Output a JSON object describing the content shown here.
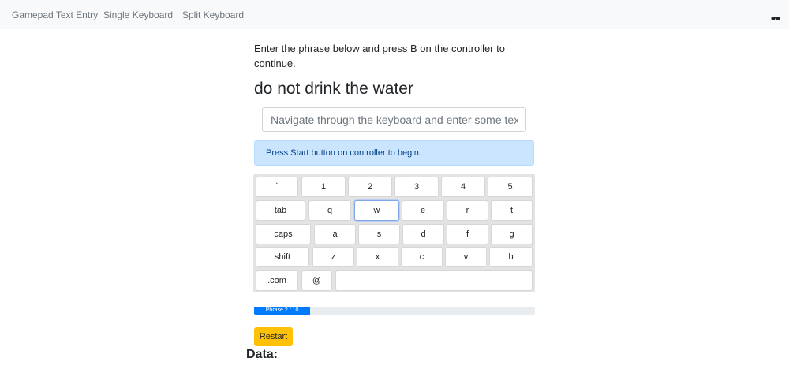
{
  "nav": {
    "links": [
      "Gamepad Text Entry",
      "Single Keyboard",
      "Split Keyboard"
    ],
    "right_icon": "glasses-icon"
  },
  "instructions": "Enter the phrase below and press B on the controller to continue.",
  "phrase": "do not drink the water",
  "input": {
    "value": "",
    "placeholder": "Navigate through the keyboard and enter some text."
  },
  "alert": "Press Start button on controller to begin.",
  "keyboard": {
    "selected_key": "w",
    "rows": [
      [
        "`",
        "1",
        "2",
        "3",
        "4",
        "5"
      ],
      [
        "tab",
        "q",
        "w",
        "e",
        "r",
        "t"
      ],
      [
        "caps",
        "a",
        "s",
        "d",
        "f",
        "g"
      ],
      [
        "shift",
        "z",
        "x",
        "c",
        "v",
        "b"
      ],
      [
        ".com",
        "@",
        ""
      ]
    ]
  },
  "progress": {
    "label": "Phrase 2 / 10",
    "current": 2,
    "total": 10
  },
  "restart_label": "Restart",
  "data_heading": "Data:",
  "colors": {
    "primary": "#007bff",
    "warning": "#ffc107",
    "alert_bg": "#cce5ff",
    "alert_text": "#004085"
  }
}
